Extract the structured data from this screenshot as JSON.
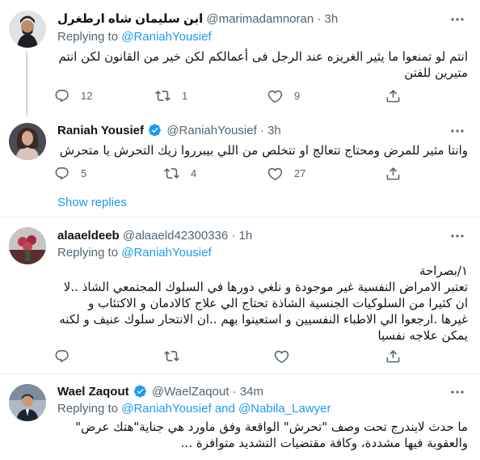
{
  "colors": {
    "accent": "#1d9bf0",
    "muted": "#536471",
    "text": "#0f1419",
    "divider": "#eff3f4"
  },
  "tweets": [
    {
      "name": "ابن سليمان شاه ارطغرل",
      "handle": "@marimadamnoran",
      "dot": "·",
      "time": "3h",
      "replying_prefix": "Replying to",
      "mentions": [
        "@RaniahYousief"
      ],
      "text": "انتم لو تمنعوا ما يثير الغريزه عند الرجل فى أعمالكم لكن خير من القانون لكن انتم متيرين للفتن",
      "counts": {
        "reply": "12",
        "retweet": "1",
        "like": "9"
      },
      "icons": [
        "reply-icon",
        "retweet-icon",
        "like-icon",
        "share-icon"
      ]
    },
    {
      "name": "Raniah Yousief",
      "verified": true,
      "handle": "@RaniahYousief",
      "dot": "·",
      "time": "3h",
      "text": "وانتا مثير للمرض ومحتاج تتعالج او تتخلص من اللي بيبرروا زيك التحرش يا متحرش",
      "counts": {
        "reply": "5",
        "retweet": "4",
        "like": "27"
      },
      "show_replies": "Show replies"
    },
    {
      "name": "alaaeldeeb",
      "handle": "@alaaeld42300336",
      "dot": "·",
      "time": "1h",
      "replying_prefix": "Replying to",
      "mentions": [
        "@RaniahYousief"
      ],
      "text_lines": [
        "١/بصراحة",
        "تعتبر الامراض النفسية غير موجودة و نلغي دورها في السلوك المجتمعي الشاذ ..لا",
        "ان كثيرا من السلوكيات الجنسية الشاذة تحتاج الي علاج كالادمان و الاكتئاب و",
        "غيرها .ارجعوا الي الاطباء النفسيين و استعينوا بهم ..ان الانتحار سلوك عنيف و لكنه",
        "يمكن علاجه نفسيا"
      ],
      "counts": {
        "reply": "",
        "retweet": "",
        "like": ""
      }
    },
    {
      "name": "Wael Zaqout",
      "verified": true,
      "handle": "@WaelZaqout",
      "dot": "·",
      "time": "34m",
      "replying_prefix": "Replying to",
      "mentions": [
        "@RaniahYousief",
        "@Nabila_Lawyer"
      ],
      "and": "and",
      "text_lines": [
        "ما حدث لايندرج تحت وصف \"تحرش\" الواقعة وفق ماورد هي جناية\"هتك عرض\"",
        "والعقوبة فيها مشددة، وكافة مقتضيات التشديد متوافرة ..."
      ]
    }
  ]
}
